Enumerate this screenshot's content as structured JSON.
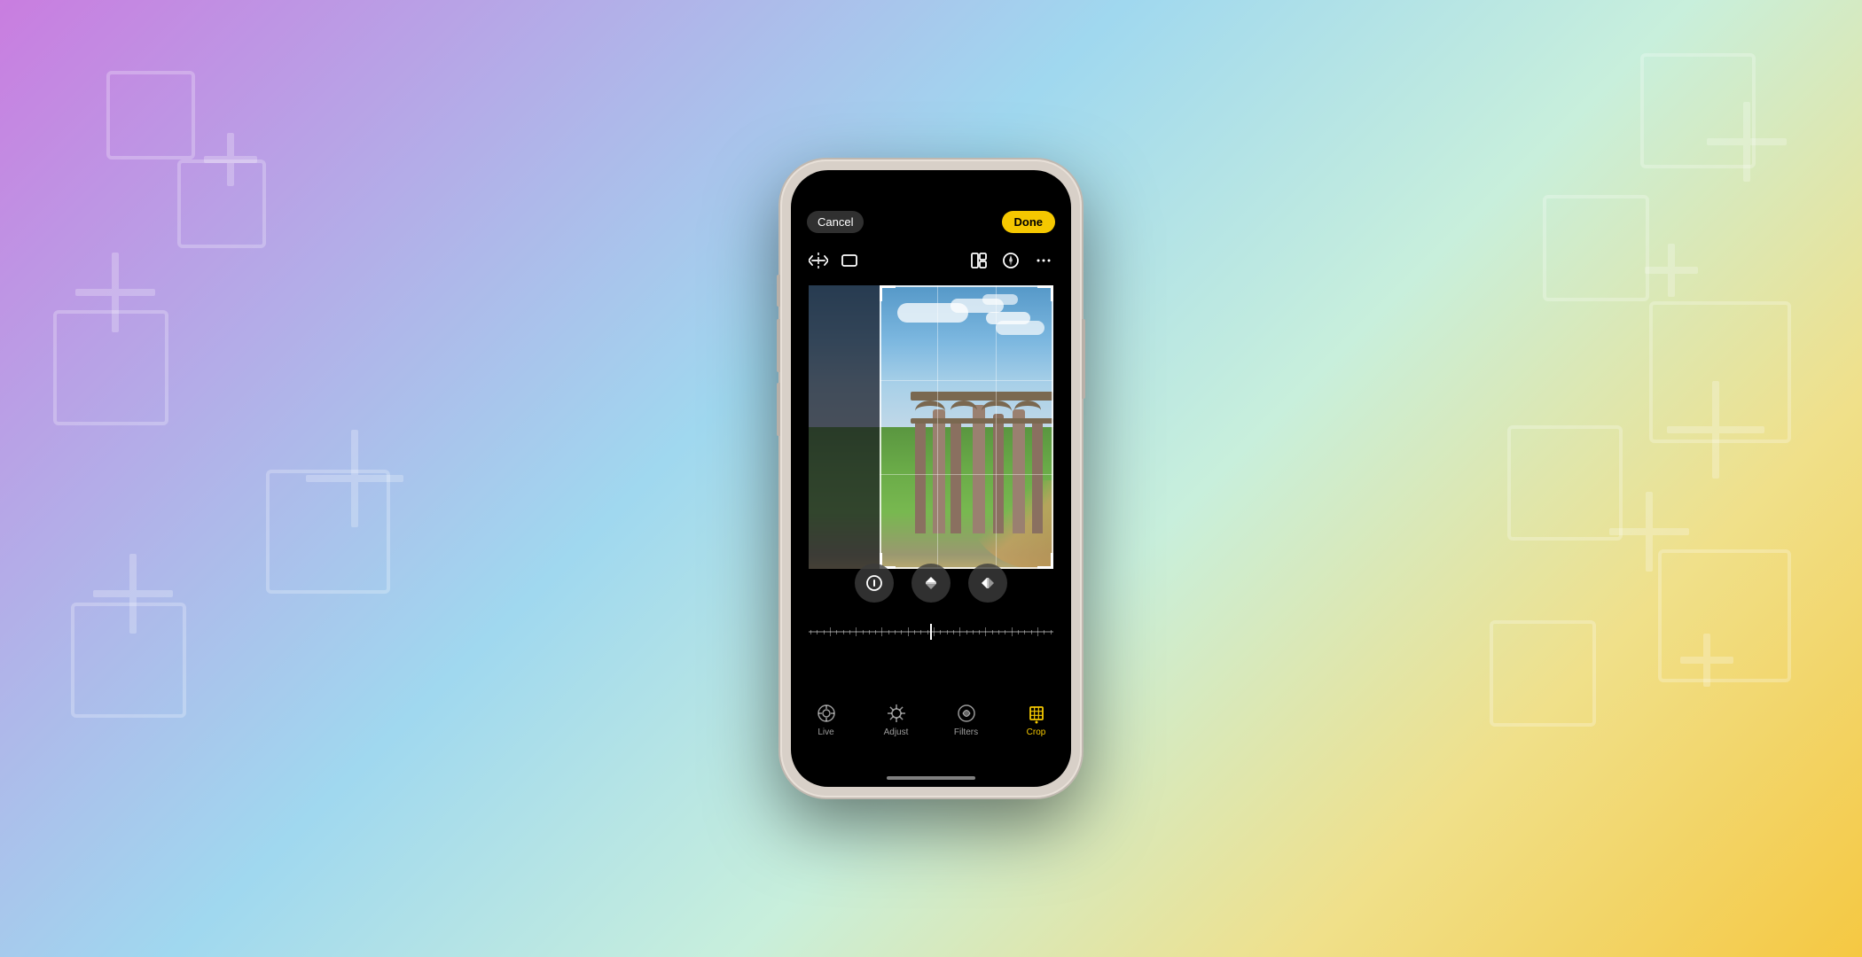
{
  "background": {
    "gradient": "linear-gradient(135deg, #c97de0, #a0d8ef, #c8efdc, #f5c842)"
  },
  "phone": {
    "cancel_label": "Cancel",
    "done_label": "Done",
    "toolbar": {
      "left_icons": [
        "flip-icon",
        "crop-aspect-icon"
      ],
      "right_icons": [
        "layout-icon",
        "compass-icon",
        "more-icon"
      ]
    },
    "tabs": [
      {
        "id": "live",
        "label": "Live",
        "icon": "live-icon",
        "active": false
      },
      {
        "id": "adjust",
        "label": "Adjust",
        "icon": "adjust-icon",
        "active": false
      },
      {
        "id": "filters",
        "label": "Filters",
        "icon": "filters-icon",
        "active": false
      },
      {
        "id": "crop",
        "label": "Crop",
        "icon": "crop-icon",
        "active": true
      }
    ],
    "rotation_buttons": [
      {
        "id": "straighten",
        "icon": "⊖"
      },
      {
        "id": "vertical",
        "icon": "▲"
      },
      {
        "id": "horizontal",
        "icon": "◀"
      }
    ]
  }
}
